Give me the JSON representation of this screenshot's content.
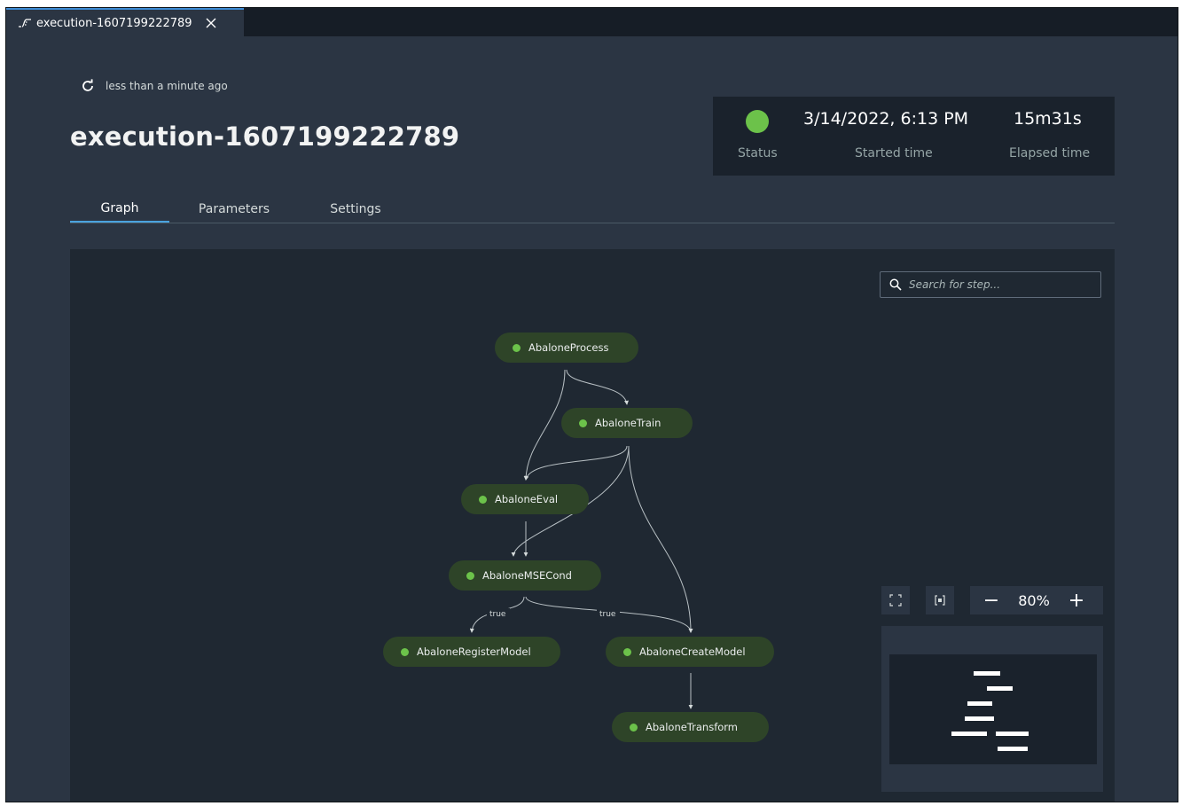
{
  "tab": {
    "title": "execution-1607199222789"
  },
  "refresh": {
    "text": "less than a minute ago"
  },
  "page": {
    "title": "execution-1607199222789"
  },
  "status_panel": {
    "status_label": "Status",
    "status_color": "#6cc24a",
    "started_value": "3/14/2022, 6:13 PM",
    "started_label": "Started time",
    "elapsed_value": "15m31s",
    "elapsed_label": "Elapsed time"
  },
  "tabs": [
    {
      "label": "Graph",
      "active": true
    },
    {
      "label": "Parameters",
      "active": false
    },
    {
      "label": "Settings",
      "active": false
    }
  ],
  "search": {
    "placeholder": "Search for step..."
  },
  "nodes": [
    {
      "label": "AbaloneProcess"
    },
    {
      "label": "AbaloneTrain"
    },
    {
      "label": "AbaloneEval"
    },
    {
      "label": "AbaloneMSECond"
    },
    {
      "label": "AbaloneRegisterModel"
    },
    {
      "label": "AbaloneCreateModel"
    },
    {
      "label": "AbaloneTransform"
    }
  ],
  "edge_labels": [
    "true",
    "true"
  ],
  "zoom": {
    "minus": "−",
    "level": "80%",
    "plus": "+"
  },
  "icons": {
    "tab": "pipeline-icon",
    "close": "close-icon",
    "refresh": "refresh-icon",
    "search": "search-icon",
    "fit": "fit-to-screen-icon",
    "center": "center-view-icon"
  },
  "colors": {
    "status_success": "#6cc24a",
    "node_background": "#2e4428",
    "active_tab_underline": "#4aa3df"
  }
}
